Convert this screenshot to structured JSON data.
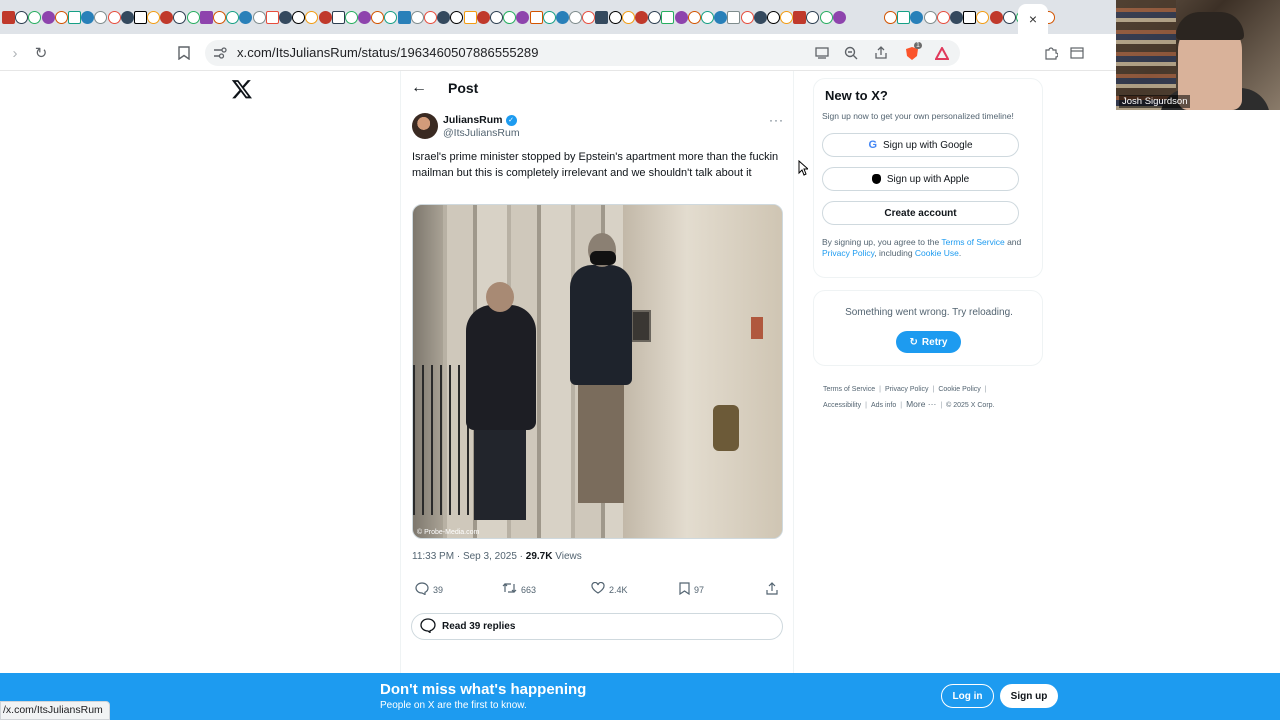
{
  "browser": {
    "url": "x.com/ItsJuliansRum/status/1963460507886555289",
    "status_url": "/x.com/ItsJuliansRum",
    "active_tab_close": "×",
    "extension_badge": "1"
  },
  "webcam": {
    "name": "Josh Sigurdson"
  },
  "post_header": {
    "title": "Post"
  },
  "tweet": {
    "display_name": "JuliansRum",
    "handle": "@ItsJuliansRum",
    "text": "Israel's prime minister stopped by Epstein's apartment more than the fuckin mailman but this is completely irrelevant and we shouldn't talk about it",
    "image_credit": "© Probe-Media.com",
    "time": "11:33 PM · Sep 3, 2025 · ",
    "views_count": "29.7K",
    "views_label": " Views",
    "replies": "39",
    "reposts": "663",
    "likes": "2.4K",
    "bookmarks": "97",
    "read_replies": "Read 39 replies"
  },
  "sidebar": {
    "title": "New to X?",
    "subtitle": "Sign up now to get your own personalized timeline!",
    "google_button": "Sign up with Google",
    "apple_button": "Sign up with Apple",
    "create_button": "Create account",
    "legal_prefix": "By signing up, you agree to the ",
    "terms_link": "Terms of Service",
    "legal_and": " and ",
    "privacy_link": "Privacy Policy",
    "legal_including": ", including ",
    "cookie_link": "Cookie Use",
    "legal_end": ".",
    "error_text": "Something went wrong. Try reloading.",
    "retry_label": "Retry",
    "footer": {
      "terms": "Terms of Service",
      "privacy": "Privacy Policy",
      "cookie": "Cookie Policy",
      "accessibility": "Accessibility",
      "ads": "Ads info",
      "more": "More ···",
      "copyright": "© 2025 X Corp."
    }
  },
  "banner": {
    "title": "Don't miss what's happening",
    "subtitle": "People on X are the first to know.",
    "login": "Log in",
    "signup": "Sign up"
  },
  "colors": {
    "accent": "#1d9bf0",
    "text": "#0f1419",
    "muted": "#536471"
  }
}
